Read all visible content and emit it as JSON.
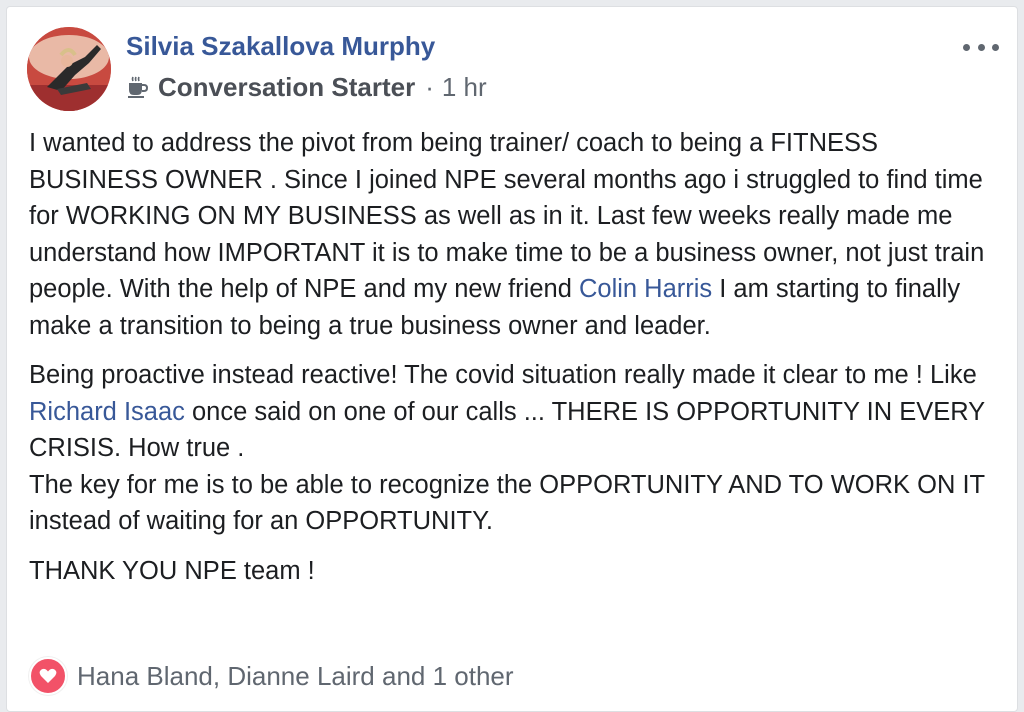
{
  "post": {
    "author": "Silvia Szakallova Murphy",
    "badge_icon": "coffee-cup-icon",
    "badge_label": "Conversation Starter",
    "separator": "·",
    "time": "1 hr",
    "more_icon": "more-options-icon",
    "paragraphs": [
      {
        "parts": [
          {
            "text": "I wanted to address the pivot from being trainer/ coach to being a FITNESS BUSINESS OWNER . Since I joined NPE several months ago i struggled to find time for WORKING ON MY BUSINESS as well as in it. Last few weeks really made me understand how IMPORTANT it is to make time to be a business owner, not just train people. With the help of NPE and my new friend "
          },
          {
            "mention": "Colin Harris"
          },
          {
            "text": " I am starting to finally make a transition to being a true business owner and leader."
          }
        ]
      },
      {
        "parts": [
          {
            "text": "Being proactive instead reactive! The covid situation really made it clear to me ! Like "
          },
          {
            "mention": "Richard Isaac"
          },
          {
            "text": " once said on one of our calls ... THERE IS OPPORTUNITY IN EVERY CRISIS. How true ."
          },
          {
            "text2": "The key for me is to be able to recognize the OPPORTUNITY AND TO WORK ON IT instead of waiting for an OPPORTUNITY."
          }
        ]
      },
      {
        "parts": [
          {
            "text": "THANK YOU NPE team !"
          }
        ]
      }
    ],
    "reactions": {
      "icon": "love-reaction-icon",
      "text": "Hana Bland, Dianne Laird and 1 other"
    }
  },
  "colors": {
    "link": "#385898",
    "text": "#1c1e21",
    "secondary": "#606770",
    "love": "#f25268"
  }
}
